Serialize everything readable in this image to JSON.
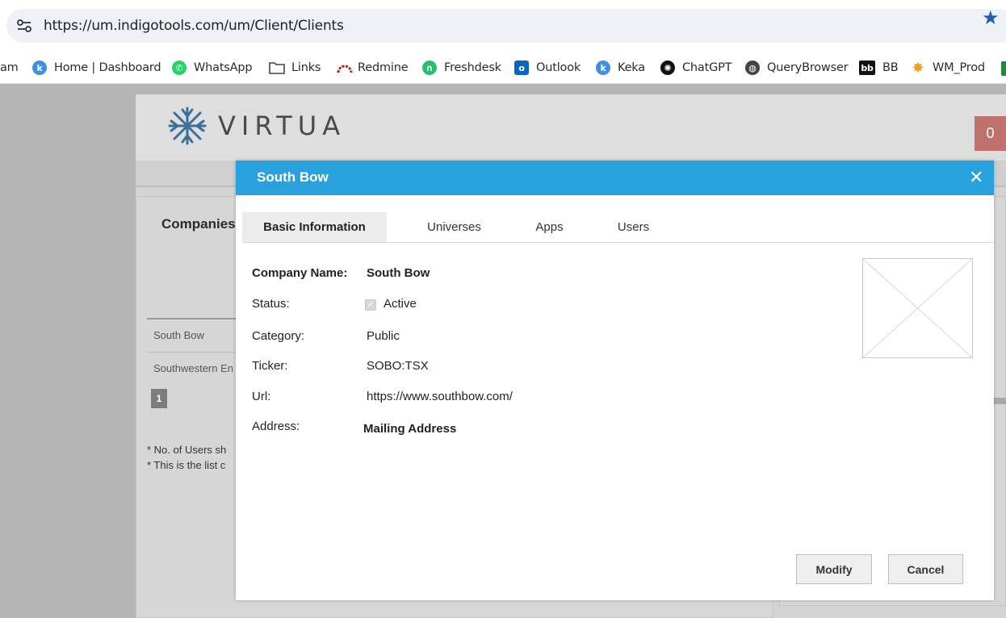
{
  "browser": {
    "url": "https://um.indigotools.com/um/Client/Clients",
    "bookmarks": [
      {
        "label": "am",
        "icon": "none"
      },
      {
        "label": "Home | Dashboard",
        "icon": "keka-icon",
        "color": "#3f8fe0"
      },
      {
        "label": "WhatsApp",
        "icon": "whatsapp-icon",
        "color": "#25d366"
      },
      {
        "label": "Links",
        "icon": "folder-icon"
      },
      {
        "label": "Redmine",
        "icon": "redmine-icon",
        "color": "#b32024"
      },
      {
        "label": "Freshdesk",
        "icon": "freshdesk-icon",
        "color": "#25c16f"
      },
      {
        "label": "Outlook",
        "icon": "outlook-icon",
        "color": "#0a64c2"
      },
      {
        "label": "Keka",
        "icon": "keka-icon",
        "color": "#3f8fe0"
      },
      {
        "label": "ChatGPT",
        "icon": "chatgpt-icon",
        "color": "#111111"
      },
      {
        "label": "QueryBrowser",
        "icon": "globe-icon",
        "color": "#444444"
      },
      {
        "label": "BB",
        "icon": "bb-icon",
        "color": "#111111"
      },
      {
        "label": "WM_Prod",
        "icon": "sun-icon",
        "color": "#f0a020"
      }
    ]
  },
  "app": {
    "logo_text": "VIRTUA",
    "notification_count": "0",
    "companies_title": "Companies",
    "rows": [
      "South Bow",
      "Southwestern En"
    ],
    "page": "1",
    "notes": [
      "* No. of Users sh",
      "* This is the list c"
    ]
  },
  "modal": {
    "title": "South Bow",
    "close_symbol": "✕",
    "tabs": [
      "Basic Information",
      "Universes",
      "Apps",
      "Users"
    ],
    "active_tab": "Basic Information",
    "fields": {
      "company_name_label": "Company Name:",
      "company_name": "South Bow",
      "status_label": "Status:",
      "status": "Active",
      "status_checked": true,
      "category_label": "Category:",
      "category": "Public",
      "ticker_label": "Ticker:",
      "ticker": "SOBO:TSX",
      "url_label": "Url:",
      "url": "https://www.southbow.com/",
      "address_label": "Address:",
      "address_heading": "Mailing Address"
    },
    "buttons": {
      "modify": "Modify",
      "cancel": "Cancel"
    }
  },
  "colors": {
    "modal_header": "#29a1dc",
    "notification_badge": "#c1716b",
    "logo_accent": "#3a6f9a"
  }
}
